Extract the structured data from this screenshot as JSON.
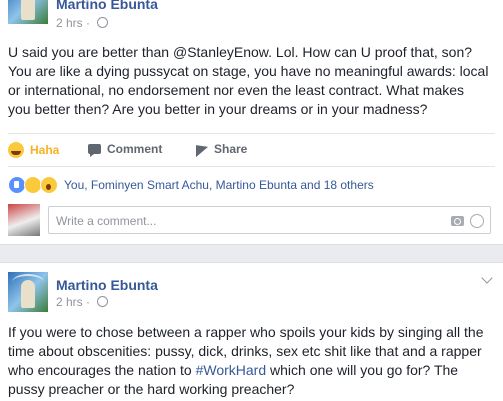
{
  "post1": {
    "author": "Martino Ebunta",
    "time": "2 hrs · ",
    "body": "U said you are better than @StanleyEnow. Lol. How can U proof that, son? You are like a dying pussycat on stage, you have no meaningful awards: local or international, no endorsement nor even the least contract. What makes you better then? Are you better in your dreams or in your madness?",
    "actions": {
      "haha": "Haha",
      "comment": "Comment",
      "share": "Share"
    },
    "reactions": "You, Fominyen Smart Achu, Martino Ebunta and 18 others",
    "comment_placeholder": "Write a comment..."
  },
  "post2": {
    "author": "Martino Ebunta",
    "time": "2 hrs · ",
    "body_before": "If you were to chose between a rapper who spoils your kids by singing all the time about obscenities: pussy, dick, drinks, sex etc shit like that and a rapper who encourages the nation to ",
    "hashtag": "#WorkHard",
    "body_after": " which one will you go for? The pussy preacher or the hard working preacher?"
  },
  "colors": {
    "link": "#365899",
    "haha": "#f7b125",
    "muted": "#90949c",
    "bg": "#e9ebee"
  }
}
